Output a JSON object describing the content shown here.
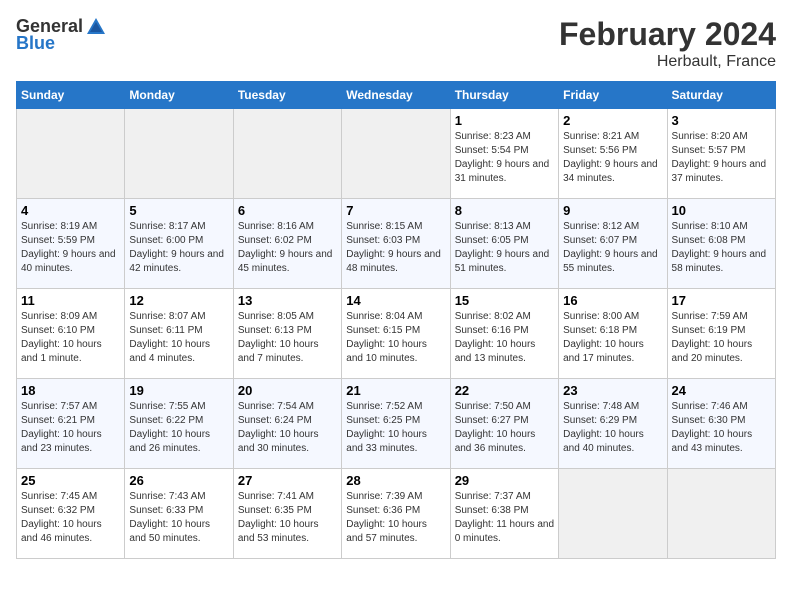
{
  "header": {
    "logo_general": "General",
    "logo_blue": "Blue",
    "month_title": "February 2024",
    "location": "Herbault, France"
  },
  "calendar": {
    "days_of_week": [
      "Sunday",
      "Monday",
      "Tuesday",
      "Wednesday",
      "Thursday",
      "Friday",
      "Saturday"
    ],
    "weeks": [
      [
        {
          "day": "",
          "empty": true
        },
        {
          "day": "",
          "empty": true
        },
        {
          "day": "",
          "empty": true
        },
        {
          "day": "",
          "empty": true
        },
        {
          "day": "1",
          "sunrise": "Sunrise: 8:23 AM",
          "sunset": "Sunset: 5:54 PM",
          "daylight": "Daylight: 9 hours and 31 minutes."
        },
        {
          "day": "2",
          "sunrise": "Sunrise: 8:21 AM",
          "sunset": "Sunset: 5:56 PM",
          "daylight": "Daylight: 9 hours and 34 minutes."
        },
        {
          "day": "3",
          "sunrise": "Sunrise: 8:20 AM",
          "sunset": "Sunset: 5:57 PM",
          "daylight": "Daylight: 9 hours and 37 minutes."
        }
      ],
      [
        {
          "day": "4",
          "sunrise": "Sunrise: 8:19 AM",
          "sunset": "Sunset: 5:59 PM",
          "daylight": "Daylight: 9 hours and 40 minutes."
        },
        {
          "day": "5",
          "sunrise": "Sunrise: 8:17 AM",
          "sunset": "Sunset: 6:00 PM",
          "daylight": "Daylight: 9 hours and 42 minutes."
        },
        {
          "day": "6",
          "sunrise": "Sunrise: 8:16 AM",
          "sunset": "Sunset: 6:02 PM",
          "daylight": "Daylight: 9 hours and 45 minutes."
        },
        {
          "day": "7",
          "sunrise": "Sunrise: 8:15 AM",
          "sunset": "Sunset: 6:03 PM",
          "daylight": "Daylight: 9 hours and 48 minutes."
        },
        {
          "day": "8",
          "sunrise": "Sunrise: 8:13 AM",
          "sunset": "Sunset: 6:05 PM",
          "daylight": "Daylight: 9 hours and 51 minutes."
        },
        {
          "day": "9",
          "sunrise": "Sunrise: 8:12 AM",
          "sunset": "Sunset: 6:07 PM",
          "daylight": "Daylight: 9 hours and 55 minutes."
        },
        {
          "day": "10",
          "sunrise": "Sunrise: 8:10 AM",
          "sunset": "Sunset: 6:08 PM",
          "daylight": "Daylight: 9 hours and 58 minutes."
        }
      ],
      [
        {
          "day": "11",
          "sunrise": "Sunrise: 8:09 AM",
          "sunset": "Sunset: 6:10 PM",
          "daylight": "Daylight: 10 hours and 1 minute."
        },
        {
          "day": "12",
          "sunrise": "Sunrise: 8:07 AM",
          "sunset": "Sunset: 6:11 PM",
          "daylight": "Daylight: 10 hours and 4 minutes."
        },
        {
          "day": "13",
          "sunrise": "Sunrise: 8:05 AM",
          "sunset": "Sunset: 6:13 PM",
          "daylight": "Daylight: 10 hours and 7 minutes."
        },
        {
          "day": "14",
          "sunrise": "Sunrise: 8:04 AM",
          "sunset": "Sunset: 6:15 PM",
          "daylight": "Daylight: 10 hours and 10 minutes."
        },
        {
          "day": "15",
          "sunrise": "Sunrise: 8:02 AM",
          "sunset": "Sunset: 6:16 PM",
          "daylight": "Daylight: 10 hours and 13 minutes."
        },
        {
          "day": "16",
          "sunrise": "Sunrise: 8:00 AM",
          "sunset": "Sunset: 6:18 PM",
          "daylight": "Daylight: 10 hours and 17 minutes."
        },
        {
          "day": "17",
          "sunrise": "Sunrise: 7:59 AM",
          "sunset": "Sunset: 6:19 PM",
          "daylight": "Daylight: 10 hours and 20 minutes."
        }
      ],
      [
        {
          "day": "18",
          "sunrise": "Sunrise: 7:57 AM",
          "sunset": "Sunset: 6:21 PM",
          "daylight": "Daylight: 10 hours and 23 minutes."
        },
        {
          "day": "19",
          "sunrise": "Sunrise: 7:55 AM",
          "sunset": "Sunset: 6:22 PM",
          "daylight": "Daylight: 10 hours and 26 minutes."
        },
        {
          "day": "20",
          "sunrise": "Sunrise: 7:54 AM",
          "sunset": "Sunset: 6:24 PM",
          "daylight": "Daylight: 10 hours and 30 minutes."
        },
        {
          "day": "21",
          "sunrise": "Sunrise: 7:52 AM",
          "sunset": "Sunset: 6:25 PM",
          "daylight": "Daylight: 10 hours and 33 minutes."
        },
        {
          "day": "22",
          "sunrise": "Sunrise: 7:50 AM",
          "sunset": "Sunset: 6:27 PM",
          "daylight": "Daylight: 10 hours and 36 minutes."
        },
        {
          "day": "23",
          "sunrise": "Sunrise: 7:48 AM",
          "sunset": "Sunset: 6:29 PM",
          "daylight": "Daylight: 10 hours and 40 minutes."
        },
        {
          "day": "24",
          "sunrise": "Sunrise: 7:46 AM",
          "sunset": "Sunset: 6:30 PM",
          "daylight": "Daylight: 10 hours and 43 minutes."
        }
      ],
      [
        {
          "day": "25",
          "sunrise": "Sunrise: 7:45 AM",
          "sunset": "Sunset: 6:32 PM",
          "daylight": "Daylight: 10 hours and 46 minutes."
        },
        {
          "day": "26",
          "sunrise": "Sunrise: 7:43 AM",
          "sunset": "Sunset: 6:33 PM",
          "daylight": "Daylight: 10 hours and 50 minutes."
        },
        {
          "day": "27",
          "sunrise": "Sunrise: 7:41 AM",
          "sunset": "Sunset: 6:35 PM",
          "daylight": "Daylight: 10 hours and 53 minutes."
        },
        {
          "day": "28",
          "sunrise": "Sunrise: 7:39 AM",
          "sunset": "Sunset: 6:36 PM",
          "daylight": "Daylight: 10 hours and 57 minutes."
        },
        {
          "day": "29",
          "sunrise": "Sunrise: 7:37 AM",
          "sunset": "Sunset: 6:38 PM",
          "daylight": "Daylight: 11 hours and 0 minutes."
        },
        {
          "day": "",
          "empty": true
        },
        {
          "day": "",
          "empty": true
        }
      ]
    ]
  }
}
